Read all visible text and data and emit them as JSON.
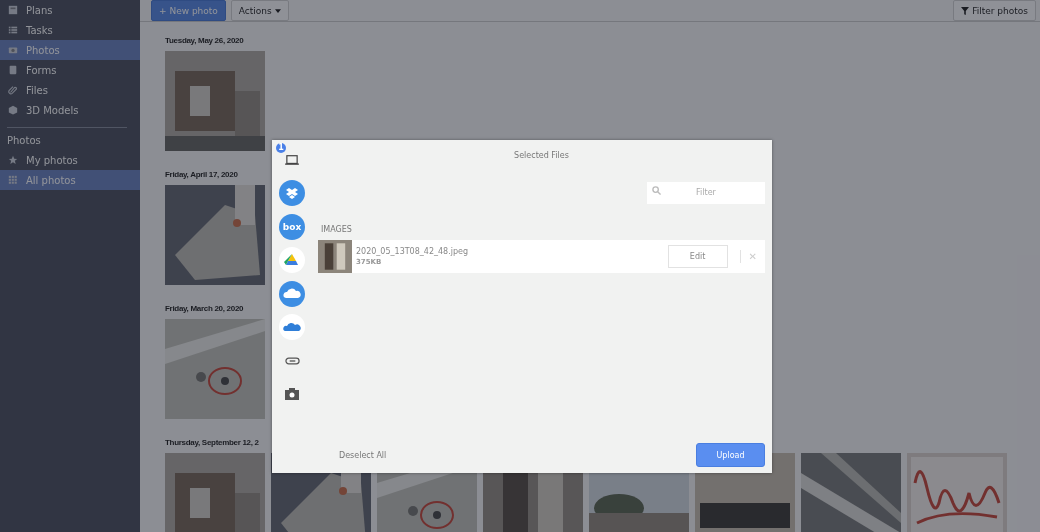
{
  "sidebar": {
    "items": [
      {
        "label": "Plans",
        "selected": false
      },
      {
        "label": "Tasks",
        "selected": false
      },
      {
        "label": "Photos",
        "selected": true
      },
      {
        "label": "Forms",
        "selected": false
      },
      {
        "label": "Files",
        "selected": false
      },
      {
        "label": "3D Models",
        "selected": false
      }
    ],
    "section_title": "Photos",
    "section_items": [
      {
        "label": "My photos",
        "selected": false
      },
      {
        "label": "All photos",
        "selected": true
      }
    ]
  },
  "toolbar": {
    "new_button": "+ New photo",
    "actions_button": "Actions",
    "filter_button": "Filter photos"
  },
  "groups": [
    {
      "date": "Tuesday, May 26, 2020"
    },
    {
      "date": "Friday, April 17, 2020"
    },
    {
      "date": "Friday, March 20, 2020"
    },
    {
      "date": "Thursday, September 12, 2"
    }
  ],
  "modal": {
    "sources": [
      {
        "kind": "computer",
        "badge": "1"
      },
      {
        "kind": "dropbox"
      },
      {
        "kind": "box",
        "label": "box"
      },
      {
        "kind": "drive"
      },
      {
        "kind": "cloud"
      },
      {
        "kind": "onedrive"
      },
      {
        "kind": "link"
      },
      {
        "kind": "camera"
      }
    ],
    "title": "Selected Files",
    "filter": {
      "placeholder": "Filter"
    },
    "section_label": "IMAGES",
    "files": [
      {
        "name": "2020_05_13T08_42_48.jpeg",
        "size": "375KB",
        "edit_button": "Edit",
        "remove": "✕"
      }
    ],
    "deselect_button": "Deselect All",
    "upload_button": "Upload"
  }
}
